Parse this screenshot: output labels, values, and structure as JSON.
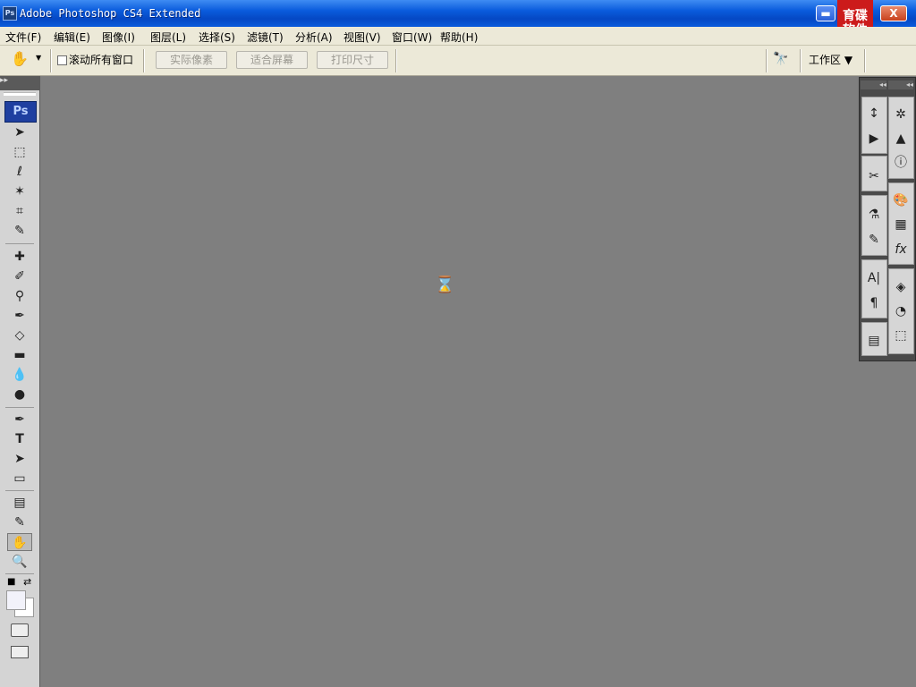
{
  "window": {
    "title": "Adobe Photoshop CS4 Extended",
    "app_icon": "Ps",
    "minimize_label": "▬",
    "close_label": "X",
    "logo_text_line1": "育碟",
    "logo_text_line2": "软件"
  },
  "menu": {
    "items": [
      "文件(F)",
      "编辑(E)",
      "图像(I)",
      "图层(L)",
      "选择(S)",
      "滤镜(T)",
      "分析(A)",
      "视图(V)",
      "窗口(W)",
      "帮助(H)"
    ]
  },
  "options": {
    "hand_icon": "✋",
    "hand_arrow": "▼",
    "scroll_all_label": "滚动所有窗口",
    "actual_pixels": "实际像素",
    "fit_screen": "适合屏幕",
    "print_size": "打印尺寸",
    "workspace_label": "工作区 ▼"
  },
  "toolbox": {
    "header": "▸▸",
    "badge": "Ps",
    "tools": [
      {
        "name": "move-tool",
        "glyph": "➤"
      },
      {
        "name": "rect-marquee-tool",
        "glyph": "⬚"
      },
      {
        "name": "lasso-tool",
        "glyph": "ℓ"
      },
      {
        "name": "magic-wand-tool",
        "glyph": "✶"
      },
      {
        "name": "crop-tool",
        "glyph": "⌗"
      },
      {
        "name": "eyedropper-tool",
        "glyph": "✎"
      },
      {
        "name": "healing-brush-tool",
        "glyph": "✚"
      },
      {
        "name": "brush-tool",
        "glyph": "✐"
      },
      {
        "name": "clone-stamp-tool",
        "glyph": "⚲"
      },
      {
        "name": "history-brush-tool",
        "glyph": "✒"
      },
      {
        "name": "eraser-tool",
        "glyph": "◇"
      },
      {
        "name": "gradient-tool",
        "glyph": "▬"
      },
      {
        "name": "blur-tool",
        "glyph": "💧"
      },
      {
        "name": "dodge-tool",
        "glyph": "●"
      },
      {
        "name": "pen-tool",
        "glyph": "✒"
      },
      {
        "name": "type-tool",
        "glyph": "T"
      },
      {
        "name": "path-selection-tool",
        "glyph": "➤"
      },
      {
        "name": "rectangle-tool",
        "glyph": "▭"
      },
      {
        "name": "notes-tool",
        "glyph": "▤"
      },
      {
        "name": "eyedropper2-tool",
        "glyph": "✎"
      },
      {
        "name": "hand-tool",
        "glyph": "✋"
      },
      {
        "name": "zoom-tool",
        "glyph": "🔍"
      }
    ],
    "swap_glyph": "⇄",
    "default_colors_glyph": "■"
  },
  "workspace": {
    "cursor": "⌛"
  },
  "right_panels": {
    "col1": [
      "↕",
      "▶",
      "✂",
      "⚗",
      "✎",
      "A|",
      "¶",
      "▤"
    ],
    "col2": [
      "✲",
      "▲",
      "ⓘ",
      "🎨",
      "▦",
      "fx",
      "◈",
      "◔",
      "⬚"
    ]
  }
}
